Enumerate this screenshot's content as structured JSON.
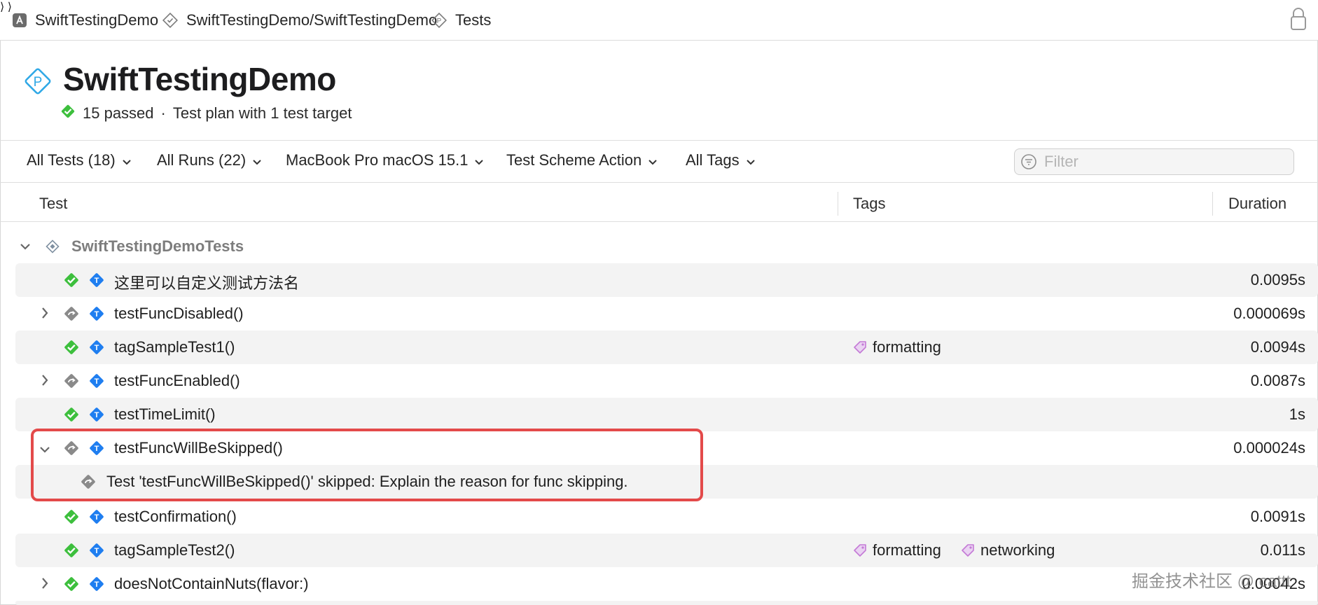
{
  "breadcrumbs": [
    {
      "label": "SwiftTestingDemo",
      "icon": "app-icon"
    },
    {
      "label": "SwiftTestingDemo/SwiftTestingDemo",
      "icon": "checkmark-diamond-icon"
    },
    {
      "label": "Tests",
      "icon": "test-plan-icon"
    }
  ],
  "header": {
    "title": "SwiftTestingDemo",
    "passed": "15 passed",
    "separator": "·",
    "description": "Test plan with 1 test target"
  },
  "filters": {
    "all_tests": "All Tests (18)",
    "all_runs": "All Runs (22)",
    "device": "MacBook Pro macOS 15.1",
    "scheme_action": "Test Scheme Action",
    "all_tags": "All Tags",
    "search_placeholder": "Filter"
  },
  "columns": {
    "test": "Test",
    "tags": "Tags",
    "duration": "Duration"
  },
  "group": {
    "name": "SwiftTestingDemoTests"
  },
  "rows": [
    {
      "name": "这里可以自定义测试方法名",
      "status": "passed",
      "expandable": false,
      "tags": [],
      "duration": "0.0095s"
    },
    {
      "name": "testFuncDisabled()",
      "status": "skipped",
      "expandable": true,
      "tags": [],
      "duration": "0.000069s"
    },
    {
      "name": "tagSampleTest1()",
      "status": "passed",
      "expandable": false,
      "tags": [
        "formatting"
      ],
      "duration": "0.0094s"
    },
    {
      "name": "testFuncEnabled()",
      "status": "skipped",
      "expandable": true,
      "tags": [],
      "duration": "0.0087s"
    },
    {
      "name": "testTimeLimit()",
      "status": "passed",
      "expandable": false,
      "tags": [],
      "duration": "1s"
    },
    {
      "name": "testFuncWillBeSkipped()",
      "status": "skipped",
      "expandable": true,
      "expanded": true,
      "tags": [],
      "duration": "0.000024s"
    },
    {
      "name": "Test 'testFuncWillBeSkipped()' skipped: Explain the reason for func skipping.",
      "status": "skipped-detail",
      "tags": [],
      "duration": ""
    },
    {
      "name": "testConfirmation()",
      "status": "passed",
      "expandable": false,
      "tags": [],
      "duration": "0.0091s"
    },
    {
      "name": "tagSampleTest2()",
      "status": "passed",
      "expandable": false,
      "tags": [
        "formatting",
        "networking"
      ],
      "duration": "0.011s"
    },
    {
      "name": "doesNotContainNuts(flavor:)",
      "status": "passed",
      "expandable": true,
      "tags": [],
      "duration": "0.00042s"
    }
  ],
  "colors": {
    "pass": "#3dbf3d",
    "test_icon": "#1f7ef0",
    "tag": "#c47ad6",
    "highlight": "#e34a4a",
    "plan_icon": "#2fa8e6"
  },
  "watermark": "掘金技术社区 @ cattt"
}
